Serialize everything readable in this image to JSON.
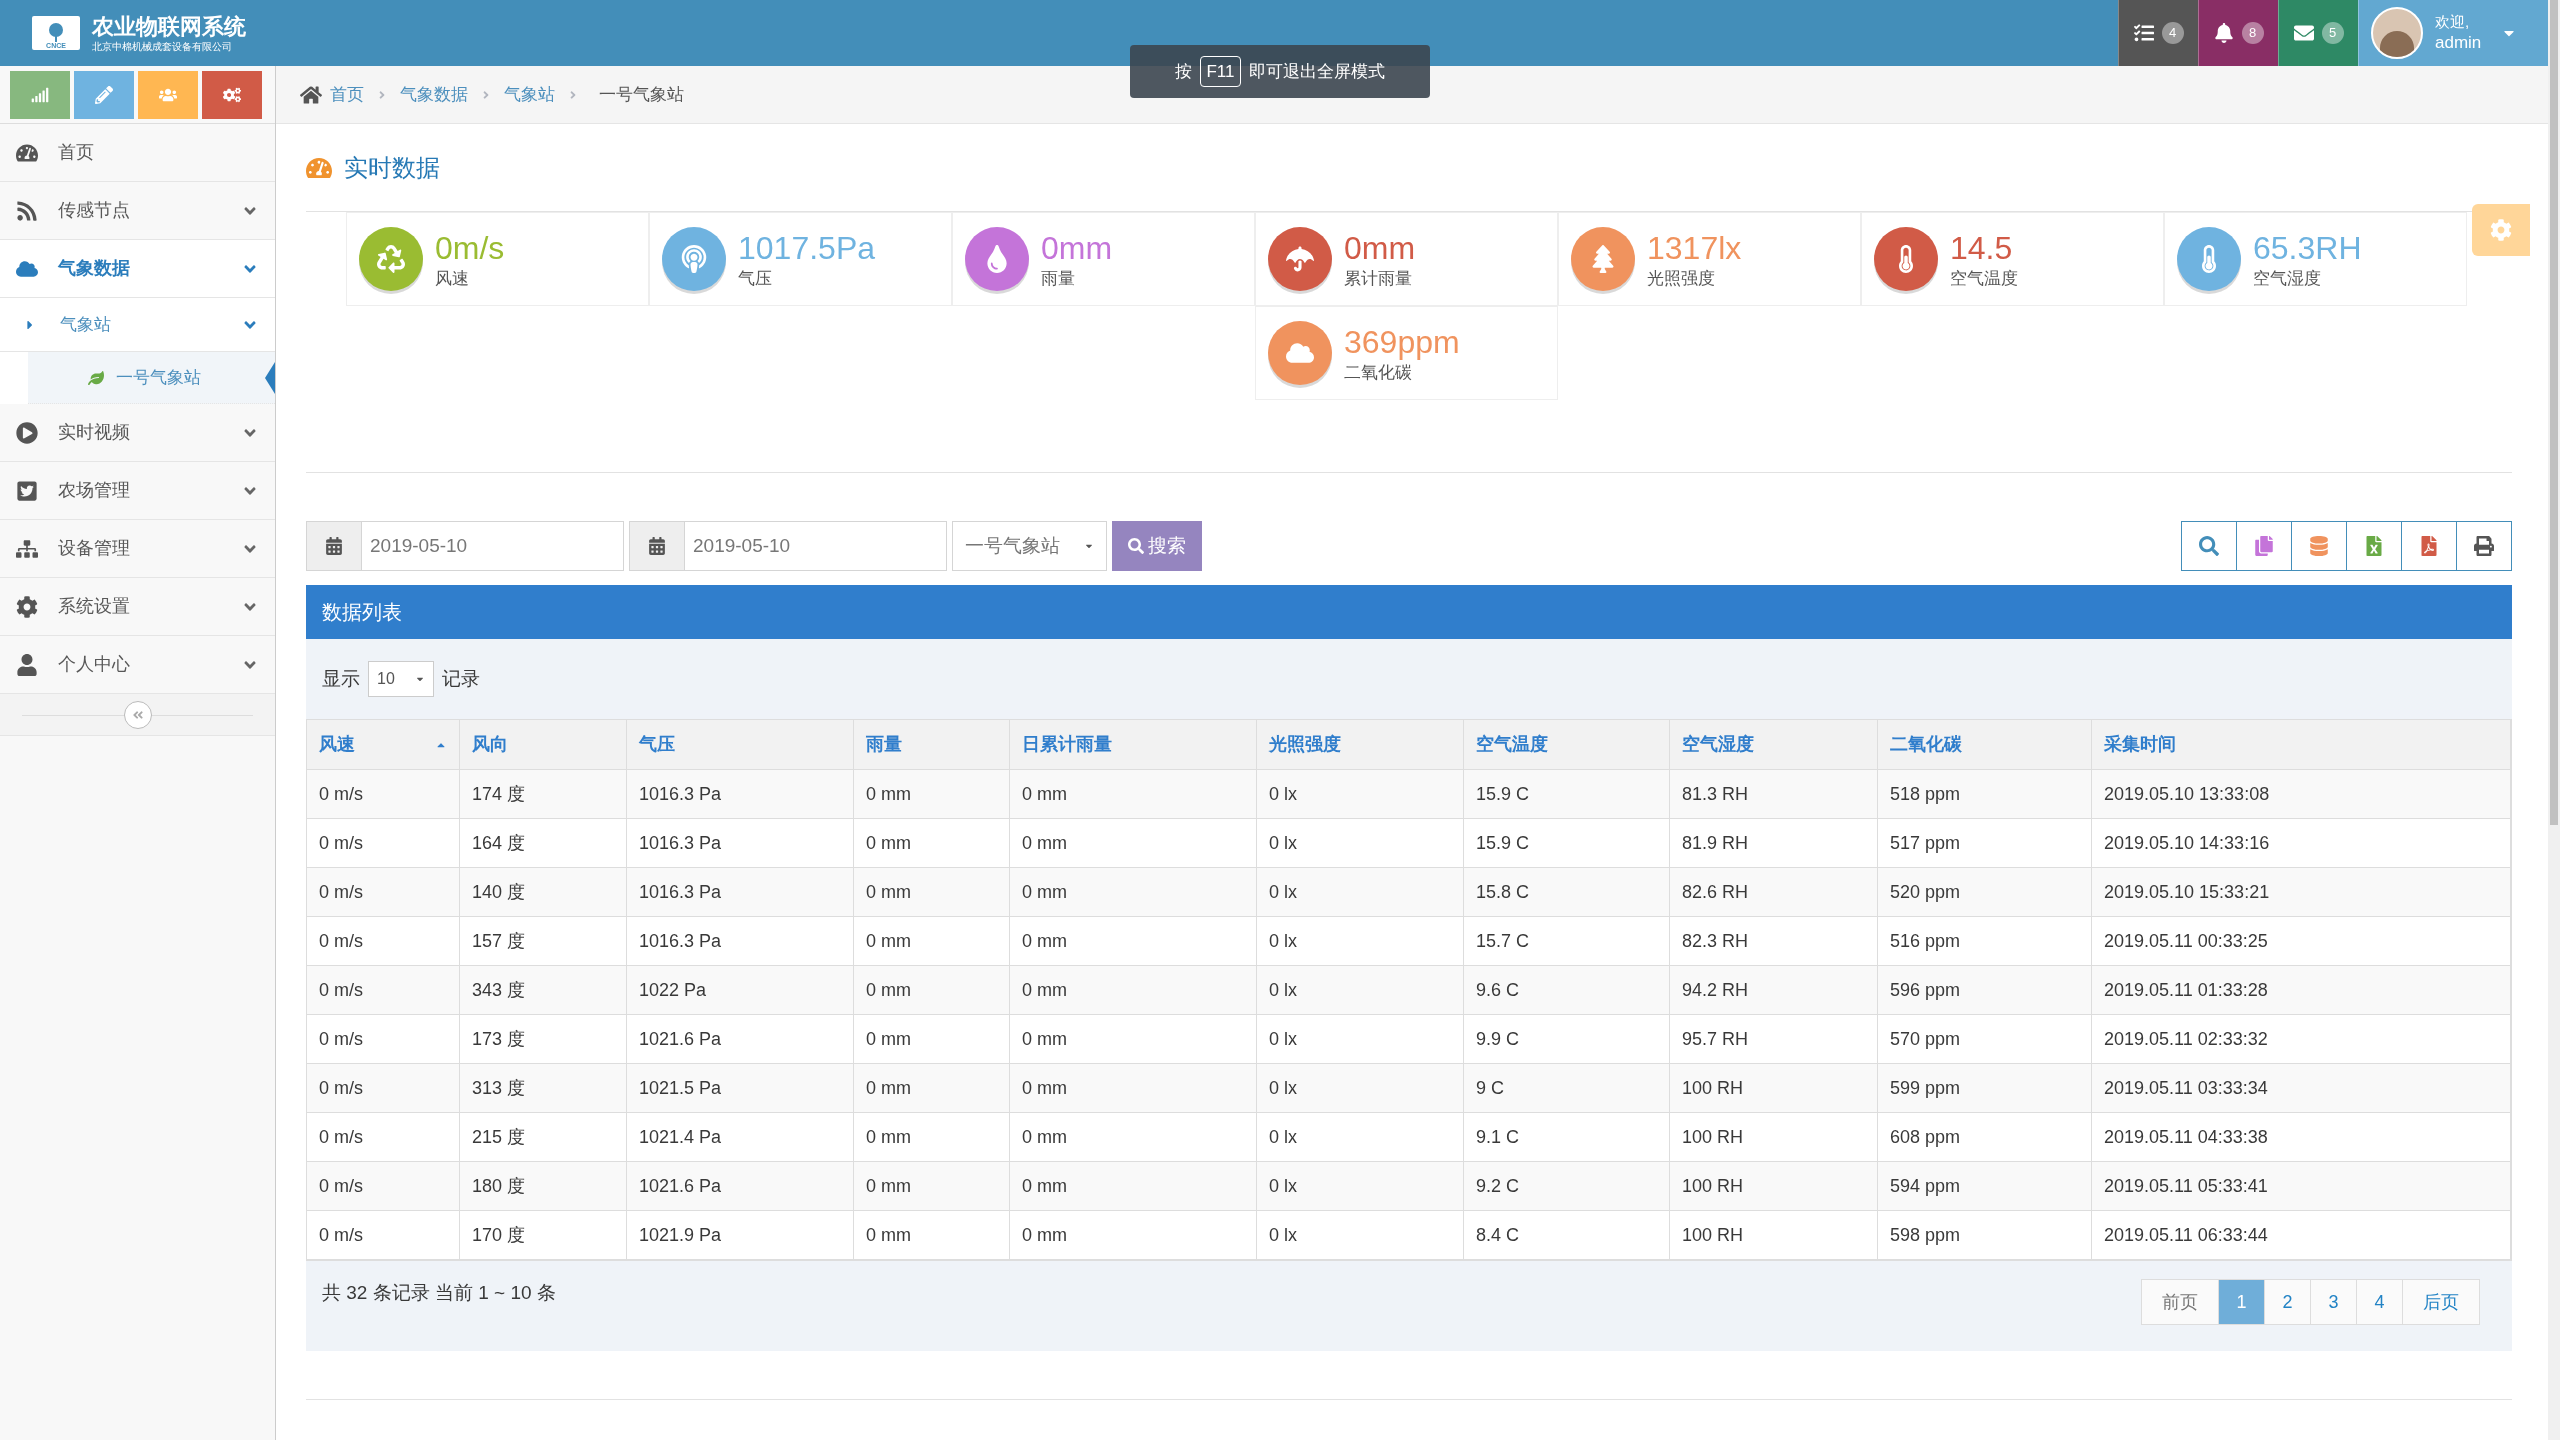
{
  "header": {
    "logo_mark": "CNCE",
    "title": "农业物联网系统",
    "subtitle": "北京中棉机械成套设备有限公司",
    "notifications": [
      {
        "count": "4",
        "color": "#555555"
      },
      {
        "count": "8",
        "color": "#892e65"
      },
      {
        "count": "5",
        "color": "#2e8965"
      }
    ],
    "welcome": "欢迎,",
    "user": "admin"
  },
  "fullscreen_hint": {
    "before": "按",
    "key": "F11",
    "after": "即可退出全屏模式"
  },
  "shortcuts": [
    {
      "color": "#87b87f"
    },
    {
      "color": "#6fb3e0"
    },
    {
      "color": "#ffb752"
    },
    {
      "color": "#d15b47"
    }
  ],
  "sidebar": {
    "items": [
      {
        "label": "首页",
        "selected": false
      },
      {
        "label": "传感节点",
        "selected": false,
        "expanded": false
      },
      {
        "label": "气象数据",
        "selected": true,
        "expanded": true,
        "children": [
          {
            "label": "气象站",
            "selected": false,
            "expanded": true,
            "children": [
              {
                "label": "一号气象站",
                "selected": true
              }
            ]
          }
        ]
      },
      {
        "label": "实时视频",
        "selected": false,
        "expanded": false
      },
      {
        "label": "农场管理",
        "selected": false,
        "expanded": false
      },
      {
        "label": "设备管理",
        "selected": false,
        "expanded": false
      },
      {
        "label": "系统设置",
        "selected": false,
        "expanded": false
      },
      {
        "label": "个人中心",
        "selected": false,
        "expanded": false
      }
    ]
  },
  "breadcrumb": [
    "首页",
    "气象数据",
    "气象站",
    "一号气象站"
  ],
  "page_title": "实时数据",
  "metrics": [
    {
      "value": "0m/s",
      "label": "风速",
      "color": "#9abc32"
    },
    {
      "value": "1017.5Pa",
      "label": "气压",
      "color": "#6fb3e0"
    },
    {
      "value": "0mm",
      "label": "雨量",
      "color": "#c474d9"
    },
    {
      "value": "0mm",
      "label": "累计雨量",
      "color": "#d15b47"
    },
    {
      "value": "1317lx",
      "label": "光照强度",
      "color": "#f0935e"
    },
    {
      "value": "14.5",
      "label": "空气温度",
      "color": "#d15b47"
    },
    {
      "value": "65.3RH",
      "label": "空气湿度",
      "color": "#6fb3e0"
    },
    {
      "value": "369ppm",
      "label": "二氧化碳",
      "color": "#f0935e"
    }
  ],
  "filters": {
    "start_date": "2019-05-10",
    "end_date": "2019-05-10",
    "station": "一号气象站",
    "search_button": "搜索"
  },
  "table": {
    "title": "数据列表",
    "show_label": "显示",
    "page_size": "10",
    "records_label": "记录",
    "columns": [
      {
        "label": "风速",
        "sorted": true
      },
      {
        "label": "风向",
        "sorted": false
      },
      {
        "label": "气压",
        "sorted": false
      },
      {
        "label": "雨量",
        "sorted": false
      },
      {
        "label": "日累计雨量",
        "sorted": false
      },
      {
        "label": "光照强度",
        "sorted": false
      },
      {
        "label": "空气温度",
        "sorted": false
      },
      {
        "label": "空气湿度",
        "sorted": false
      },
      {
        "label": "二氧化碳",
        "sorted": false
      },
      {
        "label": "采集时间",
        "sorted": false
      }
    ],
    "rows": [
      [
        "0 m/s",
        "174 度",
        "1016.3 Pa",
        "0 mm",
        "0 mm",
        "0 lx",
        "15.9 C",
        "81.3 RH",
        "518 ppm",
        "2019.05.10 13:33:08"
      ],
      [
        "0 m/s",
        "164 度",
        "1016.3 Pa",
        "0 mm",
        "0 mm",
        "0 lx",
        "15.9 C",
        "81.9 RH",
        "517 ppm",
        "2019.05.10 14:33:16"
      ],
      [
        "0 m/s",
        "140 度",
        "1016.3 Pa",
        "0 mm",
        "0 mm",
        "0 lx",
        "15.8 C",
        "82.6 RH",
        "520 ppm",
        "2019.05.10 15:33:21"
      ],
      [
        "0 m/s",
        "157 度",
        "1016.3 Pa",
        "0 mm",
        "0 mm",
        "0 lx",
        "15.7 C",
        "82.3 RH",
        "516 ppm",
        "2019.05.11 00:33:25"
      ],
      [
        "0 m/s",
        "343 度",
        "1022 Pa",
        "0 mm",
        "0 mm",
        "0 lx",
        "9.6 C",
        "94.2 RH",
        "596 ppm",
        "2019.05.11 01:33:28"
      ],
      [
        "0 m/s",
        "173 度",
        "1021.6 Pa",
        "0 mm",
        "0 mm",
        "0 lx",
        "9.9 C",
        "95.7 RH",
        "570 ppm",
        "2019.05.11 02:33:32"
      ],
      [
        "0 m/s",
        "313 度",
        "1021.5 Pa",
        "0 mm",
        "0 mm",
        "0 lx",
        "9 C",
        "100 RH",
        "599 ppm",
        "2019.05.11 03:33:34"
      ],
      [
        "0 m/s",
        "215 度",
        "1021.4 Pa",
        "0 mm",
        "0 mm",
        "0 lx",
        "9.1 C",
        "100 RH",
        "608 ppm",
        "2019.05.11 04:33:38"
      ],
      [
        "0 m/s",
        "180 度",
        "1021.6 Pa",
        "0 mm",
        "0 mm",
        "0 lx",
        "9.2 C",
        "100 RH",
        "594 ppm",
        "2019.05.11 05:33:41"
      ],
      [
        "0 m/s",
        "170 度",
        "1021.9 Pa",
        "0 mm",
        "0 mm",
        "0 lx",
        "8.4 C",
        "100 RH",
        "598 ppm",
        "2019.05.11 06:33:44"
      ]
    ],
    "summary": "共 32 条记录 当前 1 ~ 10 条"
  },
  "pagination": {
    "prev": "前页",
    "next": "后页",
    "pages": [
      {
        "label": "1",
        "selected": true
      },
      {
        "label": "2",
        "selected": false
      },
      {
        "label": "3",
        "selected": false
      },
      {
        "label": "4",
        "selected": false
      }
    ]
  }
}
